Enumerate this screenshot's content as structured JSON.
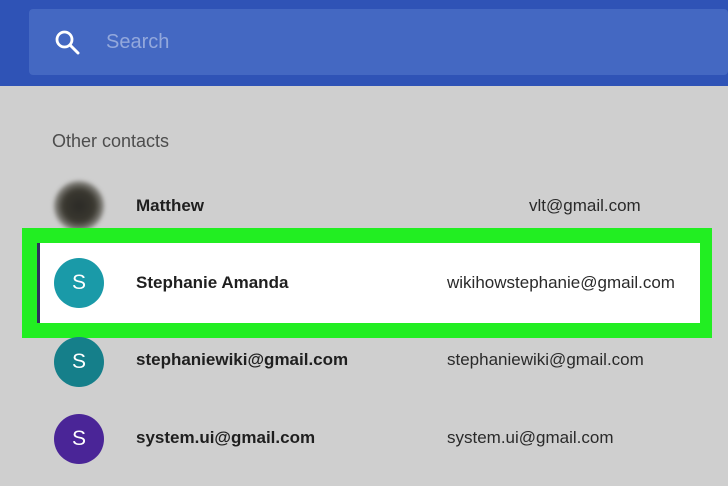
{
  "search": {
    "placeholder": "Search",
    "value": ""
  },
  "section": {
    "title": "Other contacts"
  },
  "contacts": [
    {
      "name": "Matthew",
      "email": "vlt@gmail.com",
      "avatar": "photo",
      "color": ""
    },
    {
      "name": "Stephanie Amanda",
      "email": "wikihowstephanie@gmail.com",
      "avatar": "S",
      "color": "#1a9aa8",
      "selected": true
    },
    {
      "name": "stephaniewiki@gmail.com",
      "email": "stephaniewiki@gmail.com",
      "avatar": "S",
      "color": "#157f8a"
    },
    {
      "name": "system.ui@gmail.com",
      "email": "system.ui@gmail.com",
      "avatar": "S",
      "color": "#4a2597"
    }
  ],
  "colors": {
    "topbar": "#2f53b6",
    "highlight": "#22ee22"
  }
}
